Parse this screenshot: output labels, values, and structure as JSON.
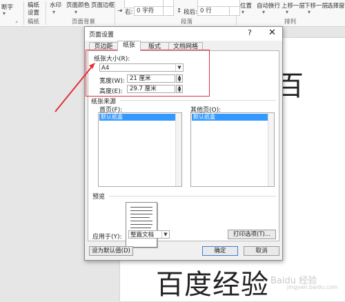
{
  "ribbon": {
    "break_label": "断字",
    "manuscript_line1": "稿纸",
    "manuscript_line2": "设置",
    "watermark_label": "水印",
    "page_color_label": "页面颜色",
    "page_border_label": "页面边框",
    "group_manuscript": "稿纸",
    "group_page_background": "页面背景",
    "group_paragraph": "段落",
    "group_arrange": "排列",
    "indent_right_label": "右:",
    "indent_right_value": "0 字符",
    "spacing_after_label": "段后:",
    "spacing_after_value": "0 行",
    "position_label": "位置",
    "wrap_text_label": "自动换行",
    "bring_forward_label": "上移一层",
    "send_backward_label": "下移一层",
    "selection_pane_label": "选择窗"
  },
  "document": {
    "top_text": "百",
    "bottom_text": "百度经验",
    "watermark_text": "Baidu 经验",
    "watermark_sub": "jingyan.baidu.com"
  },
  "dialog": {
    "title": "页面设置",
    "help_glyph": "?",
    "close_glyph": "✕",
    "tabs": [
      "页边距",
      "纸张",
      "版式",
      "文档网格"
    ],
    "paper_size_label": "纸张大小(R):",
    "paper_size_value": "A4",
    "width_label": "宽度(W):",
    "width_value": "21 厘米",
    "height_label": "高度(E):",
    "height_value": "29.7 厘米",
    "paper_source_label": "纸张来源",
    "first_page_label": "首页(F):",
    "other_pages_label": "其他页(O):",
    "first_page_selected": "默认纸盒",
    "other_pages_selected": "默认纸盒",
    "preview_label": "预览",
    "apply_to_label": "应用于(Y):",
    "apply_to_value": "整篇文档",
    "print_options_label": "打印选项(T)...",
    "set_default_label": "设为默认值(D)",
    "ok_label": "确定",
    "cancel_label": "取消"
  },
  "colors": {
    "annotation": "#e0303a",
    "selection": "#3399ff"
  }
}
